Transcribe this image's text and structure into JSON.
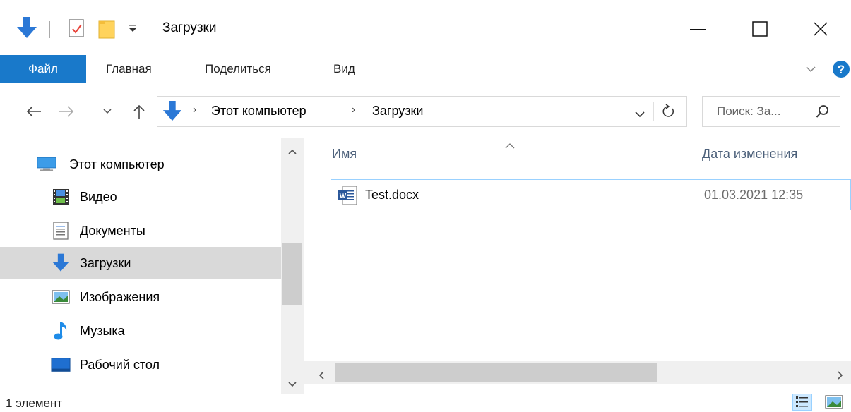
{
  "window": {
    "title": "Загрузки"
  },
  "ribbon": {
    "tabs": [
      {
        "label": "Файл"
      },
      {
        "label": "Главная"
      },
      {
        "label": "Поделиться"
      },
      {
        "label": "Вид"
      }
    ]
  },
  "address": {
    "crumbs": [
      "Этот компьютер",
      "Загрузки"
    ]
  },
  "search": {
    "placeholder": "Поиск: За..."
  },
  "nav": {
    "items": [
      {
        "label": "Этот компьютер",
        "icon": "computer-icon"
      },
      {
        "label": "Видео",
        "icon": "video-icon"
      },
      {
        "label": "Документы",
        "icon": "documents-icon"
      },
      {
        "label": "Загрузки",
        "icon": "downloads-icon"
      },
      {
        "label": "Изображения",
        "icon": "pictures-icon"
      },
      {
        "label": "Музыка",
        "icon": "music-icon"
      },
      {
        "label": "Рабочий стол",
        "icon": "desktop-icon"
      }
    ]
  },
  "columns": {
    "name": "Имя",
    "date": "Дата изменения"
  },
  "files": [
    {
      "name": "Test.docx",
      "date": "01.03.2021 12:35",
      "icon": "word-document-icon"
    }
  ],
  "status": {
    "count": "1 элемент"
  },
  "colors": {
    "accent": "#1979ca",
    "selection": "#d9d9d9",
    "file_border": "#99d1ff",
    "download_blue": "#2b78d6"
  }
}
